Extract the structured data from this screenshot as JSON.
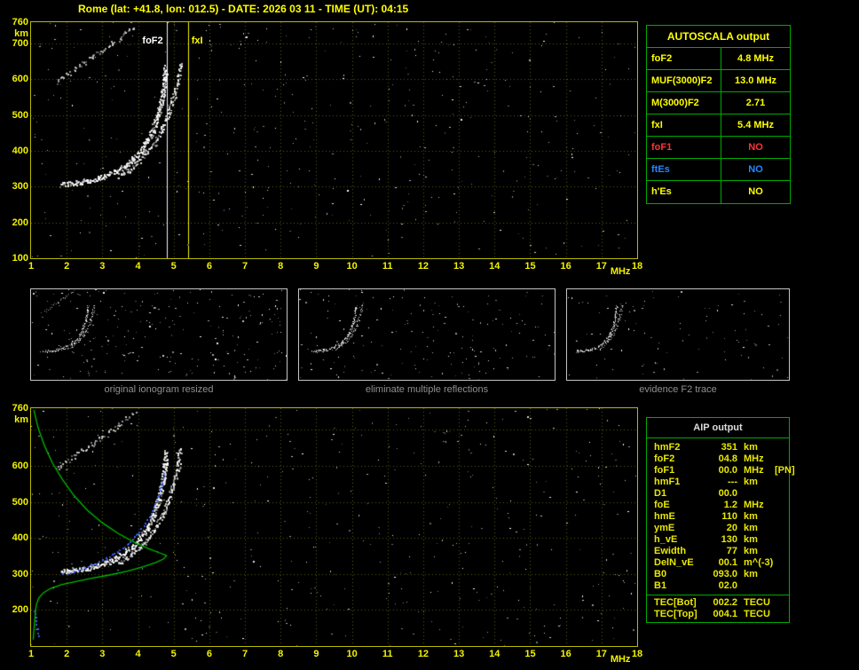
{
  "header": {
    "title": "Rome (lat: +41.8, lon: 012.5) - DATE: 2026 03 11 - TIME (UT): 04:15",
    "color": "#ffff00"
  },
  "autoscala": {
    "title": "AUTOSCALA output",
    "rows": [
      {
        "label": "foF2",
        "value": "4.8 MHz",
        "color": "#ffff00"
      },
      {
        "label": "MUF(3000)F2",
        "value": "13.0 MHz",
        "color": "#ffff00"
      },
      {
        "label": "M(3000)F2",
        "value": "2.71",
        "color": "#ffff00"
      },
      {
        "label": "fxI",
        "value": "5.4 MHz",
        "color": "#ffff00"
      },
      {
        "label": "foF1",
        "value": "NO",
        "color": "#ff3333"
      },
      {
        "label": "ftEs",
        "value": "NO",
        "color": "#2288ff"
      },
      {
        "label": "h'Es",
        "value": "NO",
        "color": "#ffff00"
      }
    ]
  },
  "aip": {
    "title": "AIP output",
    "rows": [
      {
        "label": "hmF2",
        "value": "351",
        "unit": "km",
        "note": ""
      },
      {
        "label": "foF2",
        "value": "04.8",
        "unit": "MHz",
        "note": ""
      },
      {
        "label": "foF1",
        "value": "00.0",
        "unit": "MHz",
        "note": "[PN]"
      },
      {
        "label": "hmF1",
        "value": "---",
        "unit": "km",
        "note": ""
      },
      {
        "label": "D1",
        "value": "00.0",
        "unit": "",
        "note": ""
      },
      {
        "label": "foE",
        "value": "1.2",
        "unit": "MHz",
        "note": ""
      },
      {
        "label": "hmE",
        "value": "110",
        "unit": "km",
        "note": ""
      },
      {
        "label": "ymE",
        "value": "20",
        "unit": "km",
        "note": ""
      },
      {
        "label": "h_vE",
        "value": "130",
        "unit": "km",
        "note": ""
      },
      {
        "label": "Ewidth",
        "value": "77",
        "unit": "km",
        "note": ""
      },
      {
        "label": "DelN_vE",
        "value": "00.1",
        "unit": "m^(-3)",
        "note": ""
      },
      {
        "label": "B0",
        "value": "093.0",
        "unit": "km",
        "note": ""
      },
      {
        "label": "B1",
        "value": "02.0",
        "unit": "",
        "note": ""
      }
    ],
    "tec_rows": [
      {
        "label": "TEC[Bot]",
        "value": "002.2",
        "unit": "TECU"
      },
      {
        "label": "TEC[Top]",
        "value": "004.1",
        "unit": "TECU"
      }
    ]
  },
  "panels": {
    "captions": [
      "original ionogram resized",
      "eliminate multiple reflections",
      "evidence F2 trace"
    ]
  },
  "colors": {
    "background": "#000000",
    "axis_text": "#f2f200",
    "plot_border": "#b9b900",
    "grid": "#5e5e12",
    "table_border": "#00aa00",
    "trace_white": "#ffffff",
    "profile_green": "#00bb00",
    "restored_blue": "#4466ff",
    "alert_red": "#ff3333",
    "es_blue": "#2288ff",
    "caption_gray": "#8f8f8f"
  },
  "chart_data": [
    {
      "id": "ionogram_top",
      "type": "scatter",
      "title": "ionogram with AUTOSCALA interpretation",
      "xlabel": "MHz",
      "ylabel": "km",
      "xlim": [
        1,
        18
      ],
      "ylim": [
        100,
        760
      ],
      "xticks": [
        1,
        2,
        3,
        4,
        5,
        6,
        7,
        8,
        9,
        10,
        11,
        12,
        13,
        14,
        15,
        16,
        17,
        18
      ],
      "yticks": [
        760,
        700,
        600,
        500,
        400,
        300,
        200,
        100
      ],
      "grid": true,
      "show_axis_labels": true,
      "markers": [
        {
          "name": "foF2",
          "freq": 4.8,
          "label": "foF2",
          "color": "#ffffff",
          "label_side": "left"
        },
        {
          "name": "fxI",
          "freq": 5.4,
          "label": "fxI",
          "color": "#ffff00",
          "label_side": "right"
        }
      ],
      "series": [
        {
          "name": "F2-trace-o",
          "color": "#ffffff",
          "density": 3,
          "size": 2,
          "points": [
            [
              1.85,
              308
            ],
            [
              2.1,
              311
            ],
            [
              2.35,
              314
            ],
            [
              2.6,
              318
            ],
            [
              2.85,
              324
            ],
            [
              3.1,
              332
            ],
            [
              3.35,
              343
            ],
            [
              3.6,
              358
            ],
            [
              3.85,
              378
            ],
            [
              4.05,
              400
            ],
            [
              4.25,
              428
            ],
            [
              4.4,
              458
            ],
            [
              4.52,
              492
            ],
            [
              4.62,
              528
            ],
            [
              4.69,
              565
            ],
            [
              4.74,
              602
            ],
            [
              4.77,
              638
            ]
          ]
        },
        {
          "name": "F2-trace-x",
          "color": "#f0f0f0",
          "density": 2,
          "size": 2,
          "points": [
            [
              3.45,
              330
            ],
            [
              3.7,
              346
            ],
            [
              3.95,
              366
            ],
            [
              4.2,
              392
            ],
            [
              4.45,
              424
            ],
            [
              4.65,
              460
            ],
            [
              4.82,
              498
            ],
            [
              4.95,
              536
            ],
            [
              5.05,
              574
            ],
            [
              5.13,
              612
            ],
            [
              5.19,
              650
            ]
          ]
        },
        {
          "name": "multiple-reflection",
          "color": "#d0d0d0",
          "density": 1,
          "size": 2,
          "points": [
            [
              1.7,
              593
            ],
            [
              1.95,
              610
            ],
            [
              2.2,
              627
            ],
            [
              2.45,
              645
            ],
            [
              2.7,
              662
            ],
            [
              2.95,
              680
            ],
            [
              3.2,
              698
            ],
            [
              3.45,
              716
            ],
            [
              3.7,
              734
            ],
            [
              3.9,
              750
            ]
          ]
        }
      ],
      "noise": {
        "count": 430,
        "seed": 7
      }
    },
    {
      "id": "panel_original",
      "type": "scatter",
      "xlim": [
        1,
        18
      ],
      "ylim": [
        100,
        760
      ],
      "grid": false,
      "series_ref": "ionogram_top",
      "include": [
        "F2-trace-o",
        "F2-trace-x",
        "multiple-reflection"
      ],
      "point_scale": 0.55,
      "noise": {
        "count": 240,
        "seed": 3
      }
    },
    {
      "id": "panel_no_multiples",
      "type": "scatter",
      "xlim": [
        1,
        18
      ],
      "ylim": [
        100,
        760
      ],
      "grid": false,
      "series_ref": "ionogram_top",
      "include": [
        "F2-trace-o",
        "F2-trace-x"
      ],
      "point_scale": 0.55,
      "noise": {
        "count": 170,
        "seed": 4
      }
    },
    {
      "id": "panel_f2_trace",
      "type": "scatter",
      "xlim": [
        1,
        18
      ],
      "ylim": [
        100,
        760
      ],
      "grid": false,
      "series_ref": "ionogram_top",
      "include": [
        "F2-trace-o",
        "F2-trace-x"
      ],
      "point_scale": 0.55,
      "noise": {
        "count": 100,
        "seed": 5
      }
    },
    {
      "id": "ionogram_bottom",
      "type": "scatter",
      "title": "ionogram with restored trace and electron density profile",
      "xlabel": "MHz",
      "ylabel": "km",
      "xlim": [
        1,
        18
      ],
      "ylim": [
        100,
        760
      ],
      "xticks": [
        1,
        2,
        3,
        4,
        5,
        6,
        7,
        8,
        9,
        10,
        11,
        12,
        13,
        14,
        15,
        16,
        17,
        18
      ],
      "yticks": [
        760,
        600,
        500,
        400,
        300,
        200
      ],
      "grid_yticks": [
        700,
        600,
        500,
        400,
        300,
        200
      ],
      "grid": true,
      "show_axis_labels": true,
      "series_ref": "ionogram_top",
      "include": [
        "F2-trace-o",
        "F2-trace-x",
        "multiple-reflection"
      ],
      "series": [
        {
          "name": "restored-trace",
          "draw": "dots",
          "color": "#4466ff",
          "points": [
            [
              1.9,
              300
            ],
            [
              2.2,
              308
            ],
            [
              2.5,
              318
            ],
            [
              2.8,
              330
            ],
            [
              3.1,
              344
            ],
            [
              3.4,
              362
            ],
            [
              3.7,
              384
            ],
            [
              3.95,
              410
            ],
            [
              4.2,
              442
            ],
            [
              4.4,
              478
            ],
            [
              4.55,
              515
            ],
            [
              4.65,
              550
            ],
            [
              4.72,
              582
            ]
          ]
        },
        {
          "name": "restored-E-trace",
          "draw": "dots",
          "color": "#4466ff",
          "points": [
            [
              1.08,
              200
            ],
            [
              1.12,
              172
            ],
            [
              1.16,
              148
            ],
            [
              1.2,
              128
            ]
          ]
        },
        {
          "name": "electron-density-profile",
          "draw": "line",
          "color": "#00bb00",
          "points": [
            [
              1.08,
              755
            ],
            [
              1.2,
              705
            ],
            [
              1.38,
              655
            ],
            [
              1.6,
              608
            ],
            [
              1.88,
              562
            ],
            [
              2.2,
              518
            ],
            [
              2.58,
              477
            ],
            [
              3.0,
              442
            ],
            [
              3.45,
              412
            ],
            [
              3.9,
              388
            ],
            [
              4.3,
              370
            ],
            [
              4.62,
              358
            ],
            [
              4.78,
              352
            ],
            [
              4.8,
              351
            ],
            [
              4.72,
              342
            ],
            [
              4.5,
              332
            ],
            [
              4.15,
              320
            ],
            [
              3.7,
              308
            ],
            [
              3.2,
              297
            ],
            [
              2.7,
              288
            ],
            [
              2.25,
              279
            ],
            [
              1.85,
              270
            ],
            [
              1.55,
              260
            ],
            [
              1.35,
              248
            ],
            [
              1.22,
              234
            ],
            [
              1.15,
              215
            ],
            [
              1.12,
              192
            ],
            [
              1.1,
              168
            ],
            [
              1.08,
              142
            ],
            [
              1.06,
              118
            ]
          ]
        }
      ],
      "noise": {
        "count": 430,
        "seed": 19
      }
    }
  ]
}
